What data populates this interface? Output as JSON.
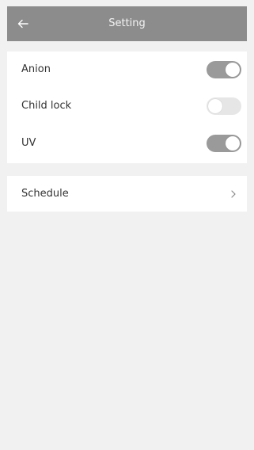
{
  "header": {
    "title": "Setting",
    "back_icon": "arrow-left-icon"
  },
  "settings": [
    {
      "label": "Anion",
      "state": "on"
    },
    {
      "label": "Child lock",
      "state": "off"
    },
    {
      "label": "UV",
      "state": "on"
    }
  ],
  "schedule": {
    "label": "Schedule",
    "icon": "chevron-right-icon"
  },
  "colors": {
    "header_bg": "#8c8c8c",
    "toggle_on": "#9a9a9a",
    "toggle_off": "#e6e6e6",
    "page_bg": "#f1f1f1"
  }
}
